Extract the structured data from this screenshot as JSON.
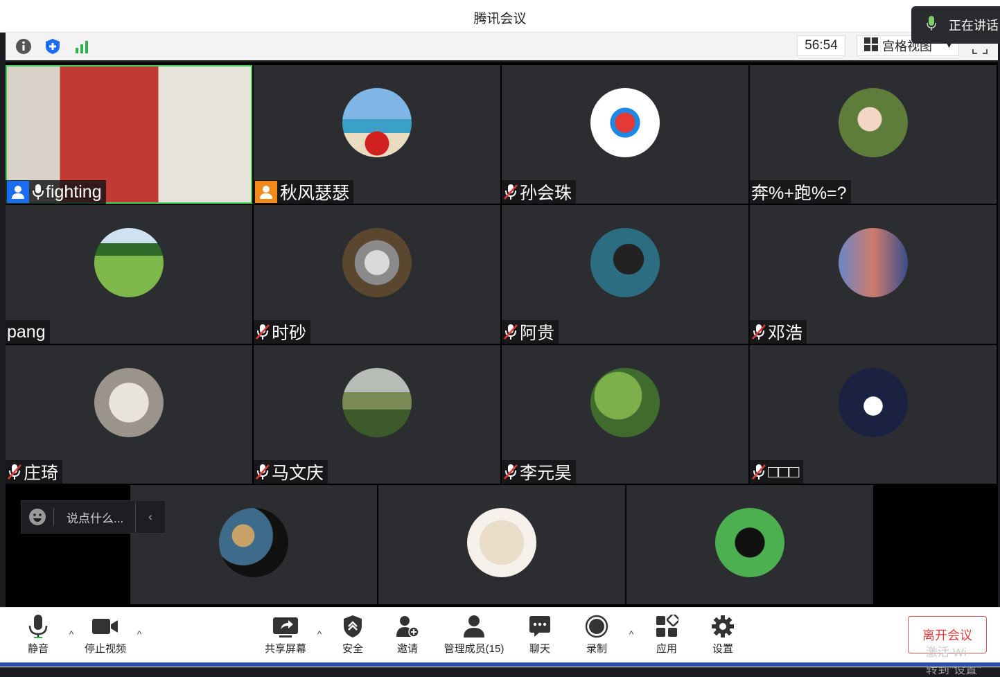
{
  "window": {
    "title": "腾讯会议"
  },
  "speaking": {
    "label": "正在讲话"
  },
  "infobar": {
    "timer": "56:54",
    "view_mode": "宫格视图"
  },
  "participants": [
    {
      "name": "fighting",
      "host_badge": true,
      "badge_color": "#1a6cf0",
      "mic": "on",
      "video": true
    },
    {
      "name": "秋风瑟瑟",
      "host_badge": true,
      "badge_color": "#f08a1a",
      "mic": "none"
    },
    {
      "name": "孙会珠",
      "mic": "off"
    },
    {
      "name": "奔%+跑%=?",
      "mic": "none"
    },
    {
      "name": "pang",
      "mic": "none"
    },
    {
      "name": "时砂",
      "mic": "off"
    },
    {
      "name": "阿贵",
      "mic": "off"
    },
    {
      "name": "邓浩",
      "mic": "off"
    },
    {
      "name": "庄琦",
      "mic": "off"
    },
    {
      "name": "马文庆",
      "mic": "off"
    },
    {
      "name": "李元昊",
      "mic": "off"
    },
    {
      "name": "□□□",
      "mic": "off"
    },
    {
      "name": "",
      "mic": "none"
    },
    {
      "name": "",
      "mic": "none"
    },
    {
      "name": "",
      "mic": "none"
    }
  ],
  "chat": {
    "placeholder": "说点什么..."
  },
  "toolbar": {
    "mute": "静音",
    "stop_video": "停止视频",
    "share_screen": "共享屏幕",
    "security": "安全",
    "invite": "邀请",
    "manage_members": "管理成员(15)",
    "chat": "聊天",
    "record": "录制",
    "apps": "应用",
    "settings": "设置",
    "leave": "离开会议"
  },
  "watermark": {
    "line1": "激活 Wi",
    "line2": "转到\"设置\""
  },
  "colors": {
    "accent": "#1a6cf0",
    "leave": "#e03c3c",
    "tile": "#2c2d30",
    "grid_bg": "#000000"
  }
}
